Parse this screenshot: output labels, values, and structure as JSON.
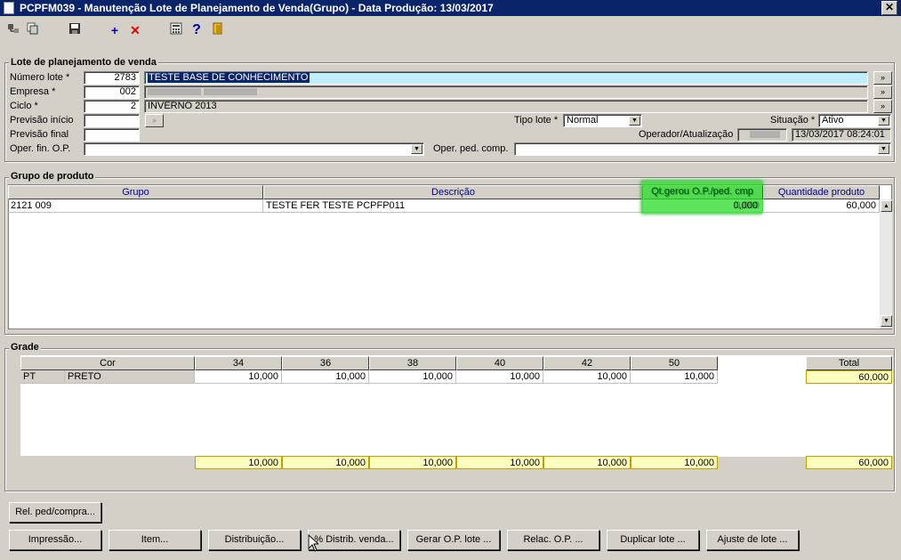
{
  "window": {
    "title": "PCPFM039 - Manutenção Lote de Planejamento de Venda(Grupo) - Data Produção: 13/03/2017",
    "close": "✕"
  },
  "toolbar": {
    "icons": [
      "tree-icon",
      "copy-icon",
      "save-icon",
      "add-icon",
      "delete-icon",
      "calculator-icon",
      "help-icon",
      "exit-icon"
    ],
    "add_glyph": "+",
    "delete_glyph": "✕",
    "help_glyph": "?"
  },
  "lote": {
    "section_title": "Lote de planejamento de venda",
    "numero_label": "Número lote *",
    "numero_value": "2783",
    "numero_desc": "TESTE BASE DE CONHECIMENTO",
    "empresa_label": "Empresa *",
    "empresa_value": "002",
    "ciclo_label": "Ciclo *",
    "ciclo_value": "2",
    "ciclo_desc": "INVERNO 2013",
    "previsao_inicio_label": "Previsão início",
    "previsao_final_label": "Previsão final",
    "oper_fin_label": "Oper. fin. O.P.",
    "oper_ped_label": "Oper. ped. comp.",
    "tipo_lote_label": "Tipo lote *",
    "tipo_lote_value": "Normal",
    "situacao_label": "Situação *",
    "situacao_value": "Ativo",
    "operador_label": "Operador/Atualização",
    "operador_date": "13/03/2017 08:24:01",
    "lookup_glyph": "»"
  },
  "grupo": {
    "section_title": "Grupo de produto",
    "columns": [
      "Grupo",
      "Descrição",
      "Qt.gerou O.P./ped. cmp",
      "Quantidade produto"
    ],
    "rows": [
      {
        "grupo": "2121 009",
        "descricao": "TESTE FER TESTE PCPFP011",
        "qt_gerou": "0,000",
        "quantidade": "60,000"
      }
    ],
    "highlight_color": "#22dd22"
  },
  "grade": {
    "section_title": "Grade",
    "cor_header": "Cor",
    "sizes": [
      "34",
      "36",
      "38",
      "40",
      "42",
      "50"
    ],
    "total_header": "Total",
    "rows": [
      {
        "code": "PT",
        "name": "PRETO",
        "values": [
          "10,000",
          "10,000",
          "10,000",
          "10,000",
          "10,000",
          "10,000"
        ],
        "total": "60,000"
      }
    ],
    "totals": [
      "10,000",
      "10,000",
      "10,000",
      "10,000",
      "10,000",
      "10,000"
    ],
    "grand_total": "60,000"
  },
  "buttons": {
    "rel_ped": "Rel. ped/compra...",
    "impressao": "Impressão...",
    "item": "Item...",
    "distribuicao": "Distribuição...",
    "distrib_venda": "% Distrib. venda...",
    "gerar_op": "Gerar O.P. lote ...",
    "relac_op": "Relac. O.P. ...",
    "duplicar": "Duplicar lote ...",
    "ajuste": "Ajuste de lote ..."
  }
}
